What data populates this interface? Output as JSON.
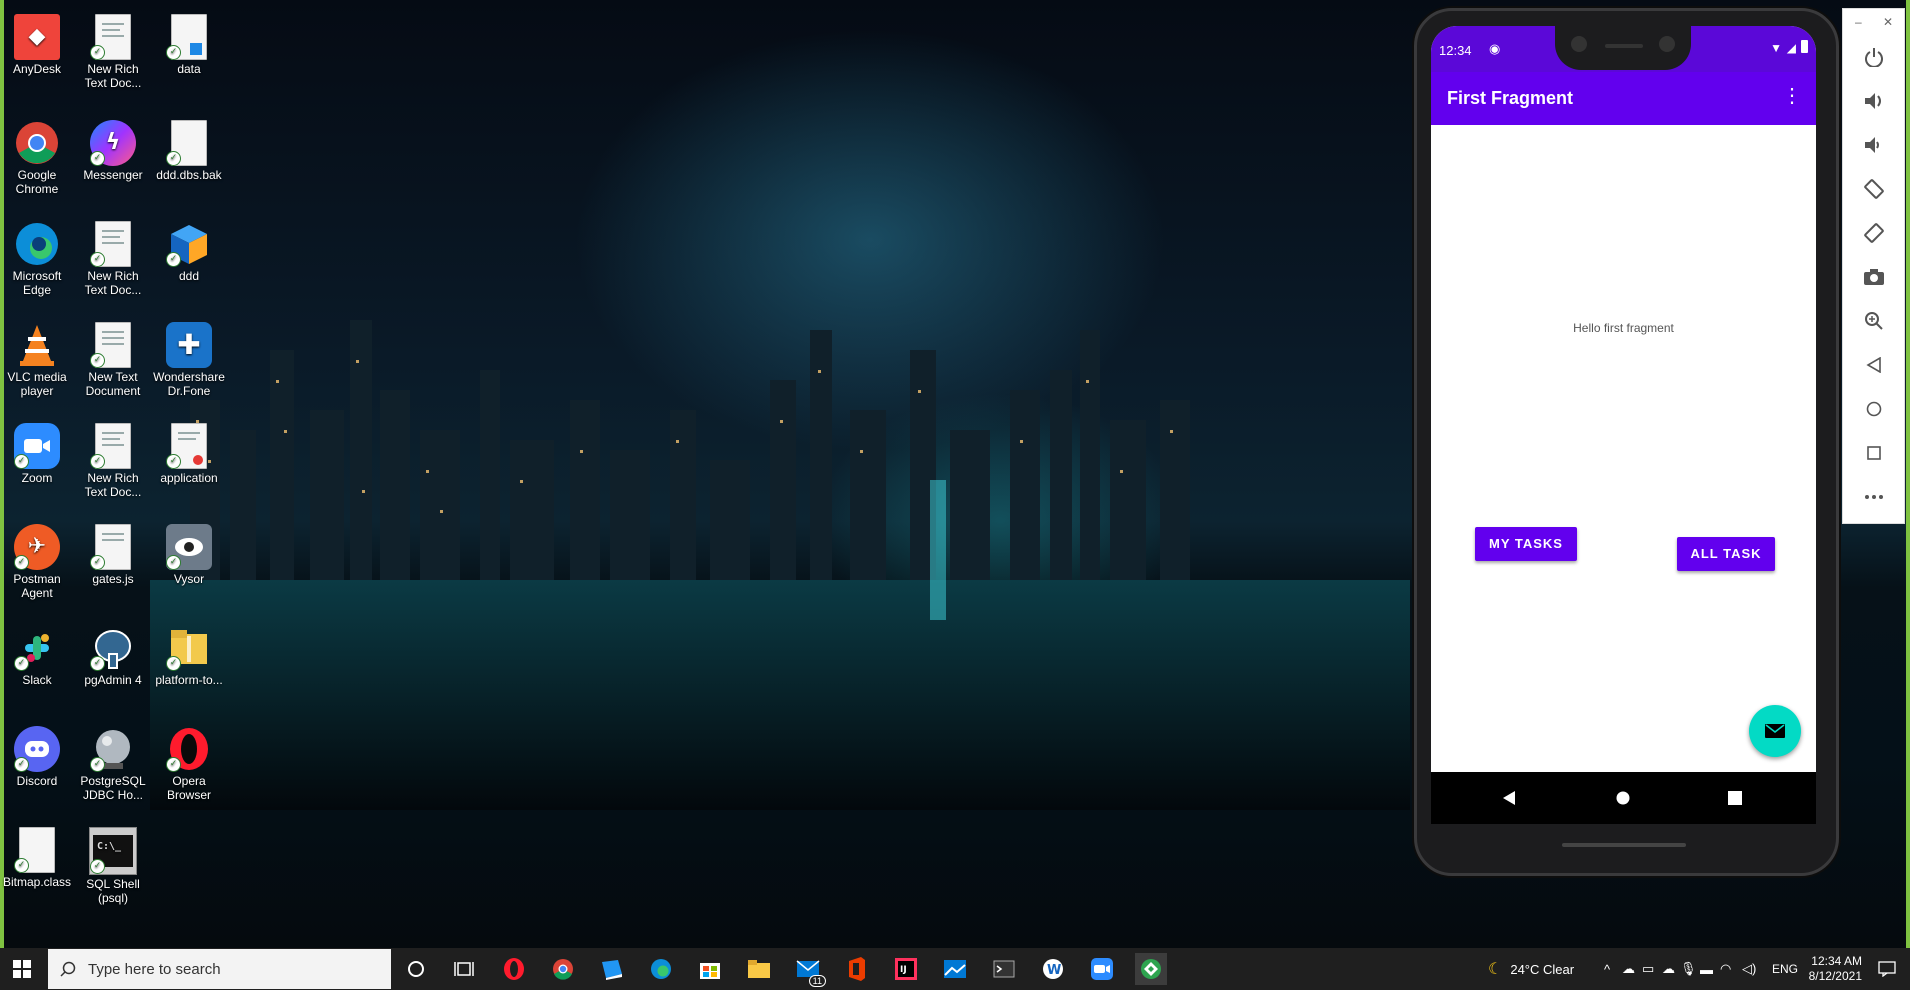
{
  "desktop": {
    "icons": [
      {
        "label": "AnyDesk"
      },
      {
        "label": "New Rich Text Doc..."
      },
      {
        "label": "data"
      },
      {
        "label": "Google Chrome"
      },
      {
        "label": "Messenger"
      },
      {
        "label": "ddd.dbs.bak"
      },
      {
        "label": "Microsoft Edge"
      },
      {
        "label": "New Rich Text Doc..."
      },
      {
        "label": "ddd"
      },
      {
        "label": "VLC media player"
      },
      {
        "label": "New Text Document"
      },
      {
        "label": "Wondershare Dr.Fone"
      },
      {
        "label": "Zoom"
      },
      {
        "label": "New Rich Text Doc..."
      },
      {
        "label": "application"
      },
      {
        "label": "Postman Agent"
      },
      {
        "label": "gates.js"
      },
      {
        "label": "Vysor"
      },
      {
        "label": "Slack"
      },
      {
        "label": "pgAdmin 4"
      },
      {
        "label": "platform-to..."
      },
      {
        "label": "Discord"
      },
      {
        "label": "PostgreSQL JDBC Ho..."
      },
      {
        "label": "Opera Browser"
      },
      {
        "label": "Bitmap.class"
      },
      {
        "label": "SQL Shell (psql)"
      }
    ]
  },
  "phone": {
    "status_time": "12:34",
    "appbar_title": "First Fragment",
    "hello_text": "Hello first fragment",
    "btn_my_tasks": "MY TASKS",
    "btn_all_task": "ALL TASK",
    "accent": "#6200ee",
    "fab_color": "#03dac5"
  },
  "taskbar": {
    "search_placeholder": "Type here to search",
    "weather": "24°C  Clear",
    "language": "ENG",
    "time": "12:34 AM",
    "date": "8/12/2021",
    "mail_badge": "11"
  }
}
